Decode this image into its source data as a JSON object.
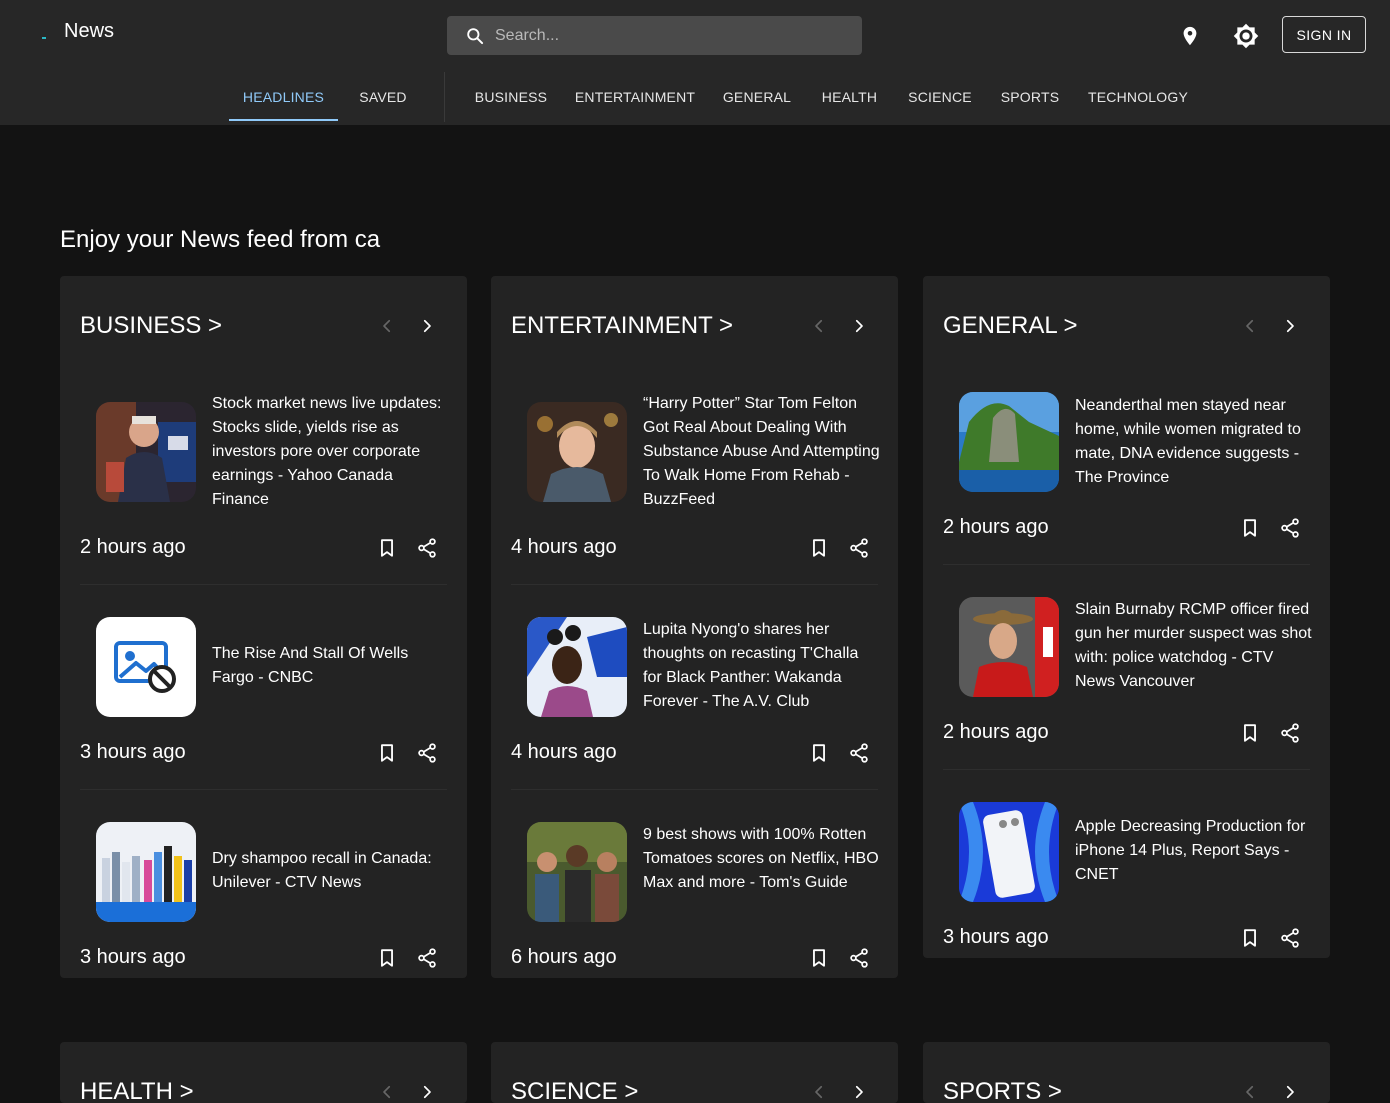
{
  "app": {
    "title": "News"
  },
  "search": {
    "placeholder": "Search..."
  },
  "signin_label": "SIGN IN",
  "tabs": [
    {
      "label": "HEADLINES"
    },
    {
      "label": "SAVED"
    },
    {
      "label": "BUSINESS"
    },
    {
      "label": "ENTERTAINMENT"
    },
    {
      "label": "GENERAL"
    },
    {
      "label": "HEALTH"
    },
    {
      "label": "SCIENCE"
    },
    {
      "label": "SPORTS"
    },
    {
      "label": "TECHNOLOGY"
    }
  ],
  "feed_heading": "Enjoy your News feed from ca",
  "sections": [
    {
      "title": "BUSINESS >",
      "articles": [
        {
          "headline": "Stock market news live updates: Stocks slide, yields rise as investors pore over corporate earnings - Yahoo Canada Finance",
          "time": "2 hours ago"
        },
        {
          "headline": "The Rise And Stall Of Wells Fargo - CNBC",
          "time": "3 hours ago"
        },
        {
          "headline": "Dry shampoo recall in Canada: Unilever - CTV News",
          "time": "3 hours ago"
        }
      ]
    },
    {
      "title": "ENTERTAINMENT >",
      "articles": [
        {
          "headline": "“Harry Potter” Star Tom Felton Got Real About Dealing With Substance Abuse And Attempting To Walk Home From Rehab - BuzzFeed",
          "time": "4 hours ago"
        },
        {
          "headline": "Lupita Nyong'o shares her thoughts on recasting T'Challa for Black Panther: Wakanda Forever - The A.V. Club",
          "time": "4 hours ago"
        },
        {
          "headline": "9 best shows with 100% Rotten Tomatoes scores on Netflix, HBO Max and more - Tom's Guide",
          "time": "6 hours ago"
        }
      ]
    },
    {
      "title": "GENERAL >",
      "articles": [
        {
          "headline": "Neanderthal men stayed near home, while women migrated to mate, DNA evidence suggests - The Province",
          "time": "2 hours ago"
        },
        {
          "headline": "Slain Burnaby RCMP officer fired gun her murder suspect was shot with: police watchdog - CTV News Vancouver",
          "time": "2 hours ago"
        },
        {
          "headline": "Apple Decreasing Production for iPhone 14 Plus, Report Says - CNET",
          "time": "3 hours ago"
        }
      ]
    },
    {
      "title": "HEALTH >"
    },
    {
      "title": "SCIENCE >"
    },
    {
      "title": "SPORTS >"
    }
  ],
  "colors": {
    "appbar": "#272727",
    "background": "#131313",
    "card": "#232323",
    "accent": "#90caf9"
  },
  "icons": [
    "search-icon",
    "location-pin-icon",
    "brightness-icon",
    "chevron-left-icon",
    "chevron-right-icon",
    "bookmark-icon",
    "share-icon",
    "image-broken-icon"
  ]
}
